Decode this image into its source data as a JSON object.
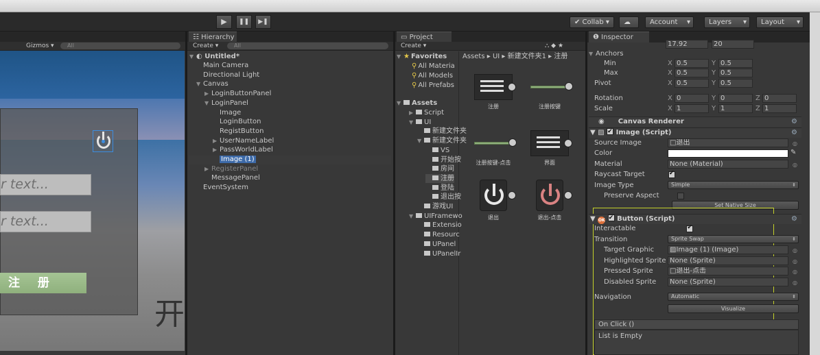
{
  "toolbar": {
    "play": "▶",
    "pause": "❚❚",
    "step": "▶❚",
    "collab": "✔ Collab ▾",
    "account": "Account",
    "layers": "Layers",
    "layout": "Layout"
  },
  "scene": {
    "gizmos": "Gizmos ▾",
    "search_placeholder": "All",
    "input1": "r text...",
    "input2": "r text...",
    "register_button": "注 册",
    "big_char": "开"
  },
  "hierarchy": {
    "tab": "Hierarchy",
    "create": "Create ▾",
    "search_placeholder": "All",
    "scene_name": "Untitled*",
    "items": [
      {
        "label": "Main Camera",
        "arrow": ""
      },
      {
        "label": "Directional Light",
        "arrow": ""
      },
      {
        "label": "Canvas",
        "arrow": "▼"
      },
      {
        "label": "LoginButtonPanel",
        "arrow": "▶"
      },
      {
        "label": "LoginPanel",
        "arrow": "▼"
      },
      {
        "label": "Image",
        "arrow": ""
      },
      {
        "label": "LoginButton",
        "arrow": ""
      },
      {
        "label": "RegistButton",
        "arrow": ""
      },
      {
        "label": "UserNameLabel",
        "arrow": "▶"
      },
      {
        "label": "PassWorldLabel",
        "arrow": "▶"
      },
      {
        "label": "Image (1)",
        "arrow": ""
      },
      {
        "label": "RegisterPanel",
        "arrow": "▶"
      },
      {
        "label": "MessagePanel",
        "arrow": ""
      },
      {
        "label": "EventSystem",
        "arrow": ""
      }
    ]
  },
  "project": {
    "tab": "Project",
    "create": "Create ▾",
    "favorites": "Favorites",
    "fav_items": [
      "All Materia",
      "All Models",
      "All Prefabs"
    ],
    "assets": "Assets",
    "tree": [
      "Script",
      "UI",
      "新建文件夹",
      "新建文件夹",
      "VS",
      "开始按",
      "房间",
      "注册",
      "登陆",
      "退出按",
      "游戏UI",
      "UIFramewo",
      "Extensio",
      "Resourc",
      "UPanel",
      "UPanelIr"
    ],
    "breadcrumb": [
      "Assets",
      "UI",
      "新建文件夹1",
      "注册"
    ],
    "asset_items": [
      "注册",
      "注册按键",
      "注册按键-点击",
      "界面",
      "退出",
      "退出-点击"
    ]
  },
  "inspector": {
    "tab": "Inspector",
    "top_values": [
      "17.92",
      "20"
    ],
    "anchors": "Anchors",
    "min": "Min",
    "max": "Max",
    "pivot": "Pivot",
    "min_x": "0.5",
    "min_y": "0.5",
    "max_x": "0.5",
    "max_y": "0.5",
    "pivot_x": "0.5",
    "pivot_y": "0.5",
    "rotation": "Rotation",
    "rot_x": "0",
    "rot_y": "0",
    "rot_z": "0",
    "scale": "Scale",
    "scale_x": "1",
    "scale_y": "1",
    "scale_z": "1",
    "canvas_renderer": "Canvas Renderer",
    "image_script": "Image (Script)",
    "source_image": "Source Image",
    "source_image_val": "退出",
    "color": "Color",
    "material": "Material",
    "material_val": "None (Material)",
    "raycast": "Raycast Target",
    "image_type": "Image Type",
    "image_type_val": "Simple",
    "preserve": "Preserve Aspect",
    "set_native": "Set Native Size",
    "button_script": "Button (Script)",
    "interactable": "Interactable",
    "transition": "Transition",
    "transition_val": "Sprite Swap",
    "target_graphic": "Target Graphic",
    "target_graphic_val": "Image (1) (Image)",
    "highlighted": "Highlighted Sprite",
    "highlighted_val": "None (Sprite)",
    "pressed": "Pressed Sprite",
    "pressed_val": "退出-点击",
    "disabled": "Disabled Sprite",
    "disabled_val": "None (Sprite)",
    "navigation": "Navigation",
    "navigation_val": "Automatic",
    "visualize": "Visualize",
    "onclick": "On Click ()",
    "list_empty": "List is Empty"
  }
}
